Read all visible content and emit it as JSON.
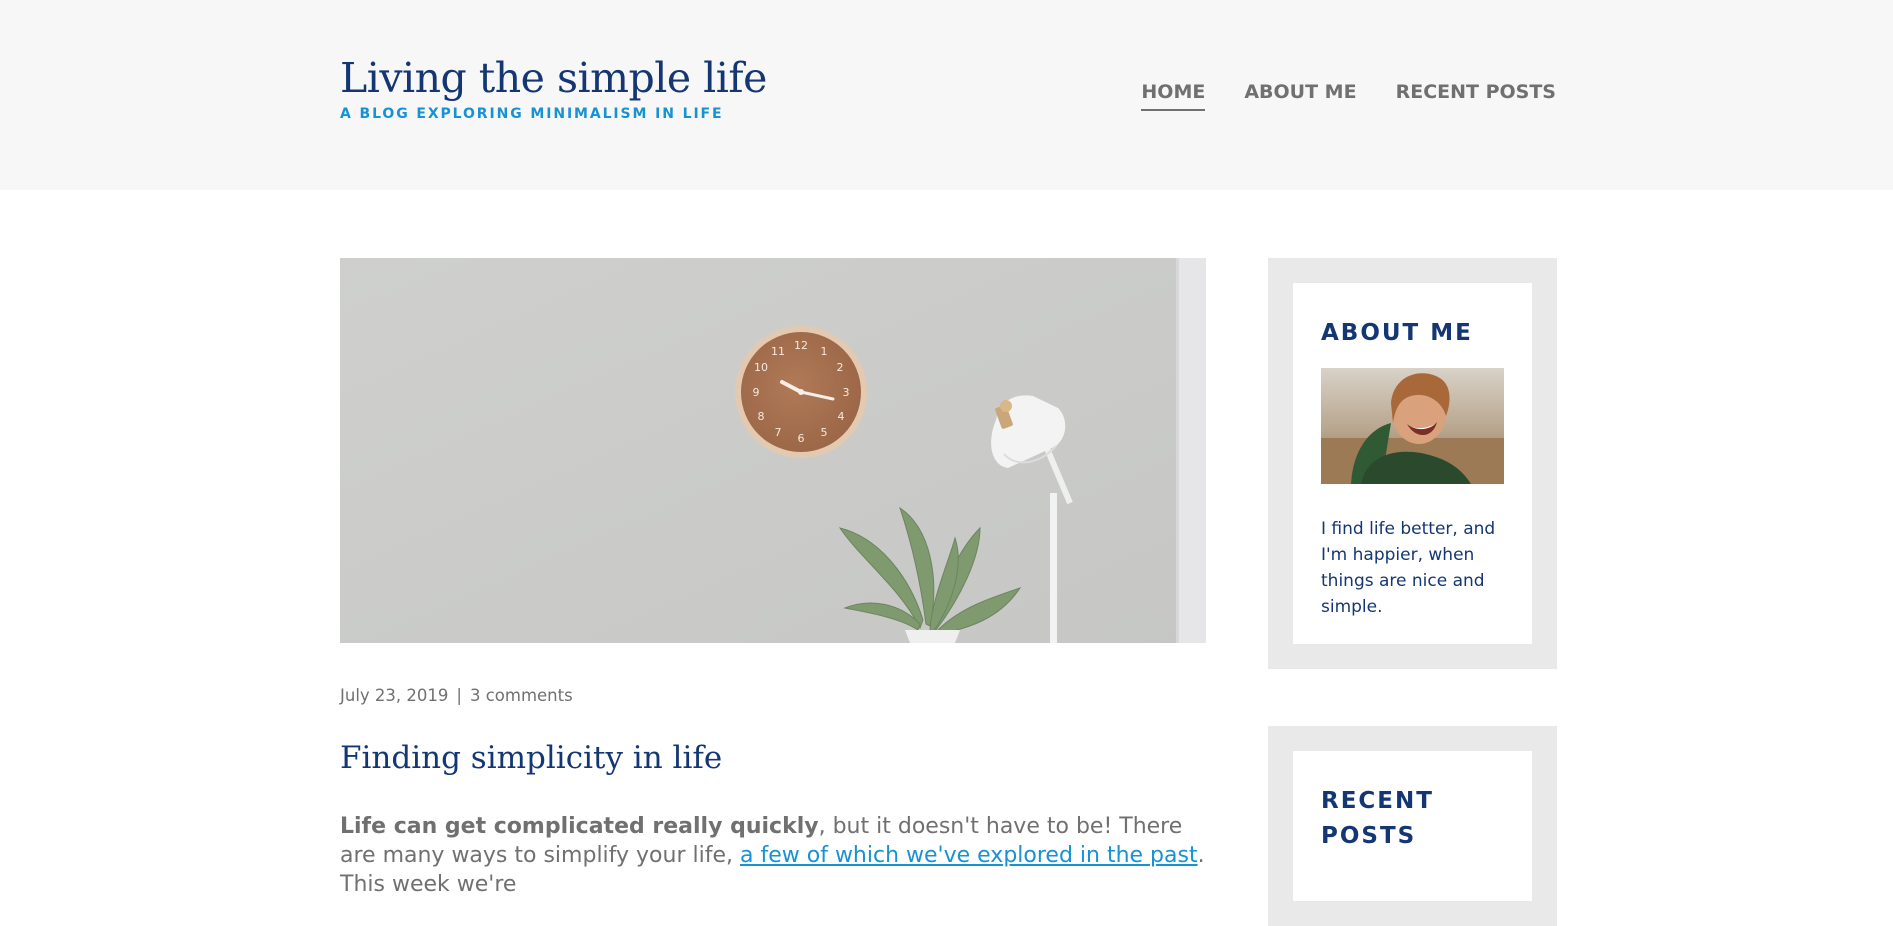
{
  "header": {
    "site_title": "Living the simple life",
    "site_subtitle": "A BLOG EXPLORING MINIMALISM IN LIFE",
    "nav": [
      {
        "label": "HOME",
        "active": true
      },
      {
        "label": "ABOUT ME",
        "active": false
      },
      {
        "label": "RECENT POSTS",
        "active": false
      }
    ]
  },
  "post": {
    "date": "July 23, 2019",
    "separator": "|",
    "comments": "3 comments",
    "title": "Finding simplicity in life",
    "body_bold": "Life can get complicated really quickly",
    "body_text_1": ", but it doesn't have to be! There are many ways to simplify your life, ",
    "body_link": "a few of which we've explored in the past",
    "body_text_2": ". This week we're"
  },
  "sidebar": {
    "about": {
      "title": "ABOUT ME",
      "text": "I find life better, and I'm happier, when things are nice and simple."
    },
    "recent": {
      "title": "RECENT POSTS"
    }
  },
  "colors": {
    "brand_dark": "#143774",
    "brand_light": "#1792d2",
    "text_gray": "#707070",
    "header_bg": "#f7f7f7",
    "widget_bg": "#e9e9e9"
  }
}
